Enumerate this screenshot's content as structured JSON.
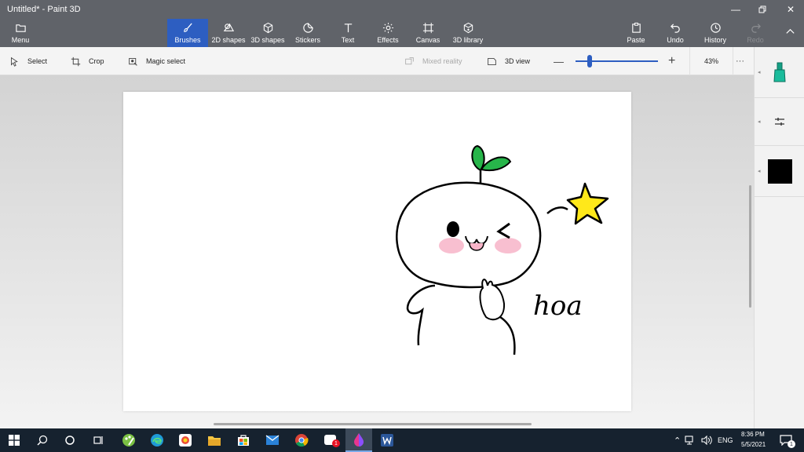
{
  "window": {
    "title": "Untitled* - Paint 3D"
  },
  "ribbon": {
    "menu": "Menu",
    "brushes": "Brushes",
    "shapes2d": "2D shapes",
    "shapes3d": "3D shapes",
    "stickers": "Stickers",
    "text": "Text",
    "effects": "Effects",
    "canvas": "Canvas",
    "library3d": "3D library",
    "paste": "Paste",
    "undo": "Undo",
    "history": "History",
    "redo": "Redo"
  },
  "toolbar": {
    "select": "Select",
    "crop": "Crop",
    "magic_select": "Magic select",
    "mixed_reality": "Mixed reality",
    "view3d": "3D view",
    "zoom_value": "43%",
    "zoom_fraction": 0.17,
    "more": "···"
  },
  "canvas": {
    "handwriting": "hoa"
  },
  "side_panel": {
    "current_color": "#000000"
  },
  "taskbar": {
    "language": "ENG",
    "time": "8:36 PM",
    "date": "5/5/2021",
    "notification_count": "1",
    "mail_badge": "1"
  },
  "colors": {
    "ribbon_bg": "#606369",
    "accent": "#2d5ec1",
    "taskbar_bg": "#16222f"
  }
}
